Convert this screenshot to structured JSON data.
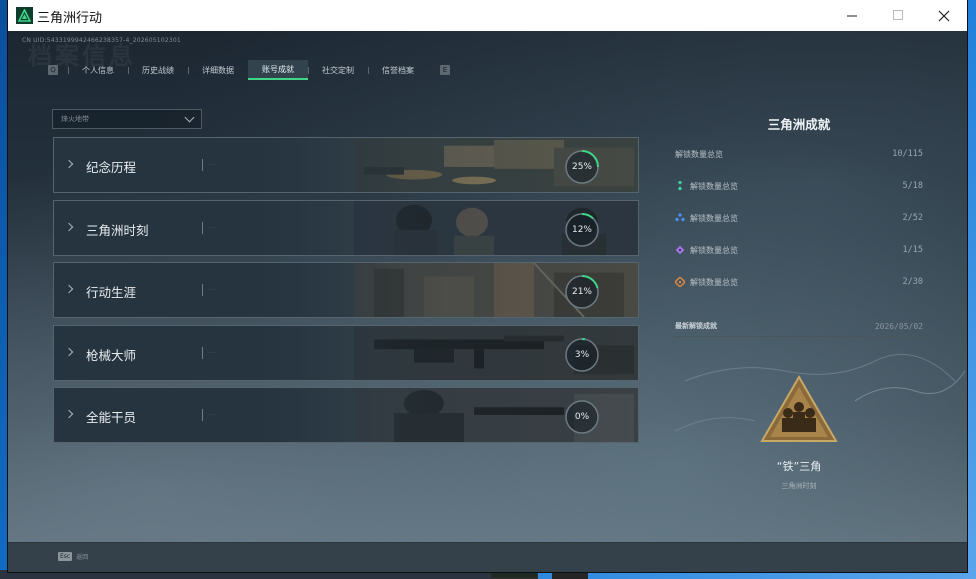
{
  "window": {
    "title": "三角洲行动"
  },
  "header": {
    "uid": "CN UID:5433199942466238357-4_202605102301",
    "watermark": "档案信息"
  },
  "tabs": [
    {
      "label": "个人信息"
    },
    {
      "label": "历史战绩"
    },
    {
      "label": "详细数据"
    },
    {
      "label": "账号成就",
      "active": true
    },
    {
      "label": "社交定制"
    },
    {
      "label": "信誉档案"
    }
  ],
  "tab_nav": {
    "prev": "Q",
    "next": "E"
  },
  "filter": {
    "value": "烽火地带"
  },
  "categories": [
    {
      "title": "纪念历程",
      "progress": 25,
      "progress_label": "25%"
    },
    {
      "title": "三角洲时刻",
      "progress": 12,
      "progress_label": "12%"
    },
    {
      "title": "行动生涯",
      "progress": 21,
      "progress_label": "21%"
    },
    {
      "title": "枪械大师",
      "progress": 3,
      "progress_label": "3%"
    },
    {
      "title": "全能干员",
      "progress": 0,
      "progress_label": "0%"
    }
  ],
  "summary": {
    "title": "三角洲成就",
    "total": {
      "label": "解锁数量总览",
      "value": "10/115"
    },
    "tiers": [
      {
        "label": "解锁数量总览",
        "value": "5/18",
        "icon": "teal-tier-icon",
        "color": "#3fd6a8"
      },
      {
        "label": "解锁数量总览",
        "value": "2/52",
        "icon": "blue-tier-icon",
        "color": "#4a8ff0"
      },
      {
        "label": "解锁数量总览",
        "value": "1/15",
        "icon": "purple-tier-icon",
        "color": "#a876e8"
      },
      {
        "label": "解锁数量总览",
        "value": "2/30",
        "icon": "orange-tier-icon",
        "color": "#e58a3a"
      }
    ]
  },
  "latest": {
    "label": "最新解锁成就",
    "date": "2026/05/02",
    "name": "“铁”三角",
    "category": "三角洲时刻"
  },
  "footer": {
    "key": "Esc",
    "label": "返回"
  },
  "colors": {
    "accent": "#3fd68a"
  }
}
